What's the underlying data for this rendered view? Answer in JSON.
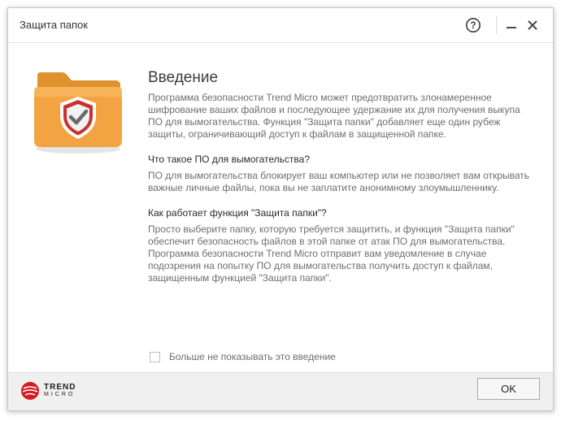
{
  "window": {
    "title": "Защита папок",
    "help_label": "?"
  },
  "intro": {
    "heading": "Введение",
    "paragraph": "Программа безопасности Trend Micro может предотвратить злонамеренное шифрование ваших файлов и последующее удержание их для получения выкупа ПО для вымогательства. Функция \"Защита папки\" добавляет еще один рубеж защиты, ограничивающий доступ к файлам в защищенной папке.",
    "q1": "Что такое ПО для вымогательства?",
    "a1": "ПО для вымогательства блокирует ваш компьютер или не позволяет вам открывать важные личные файлы, пока вы не заплатите анонимному злоумышленнику.",
    "q2": "Как работает функция \"Защита папки\"?",
    "a2": "Просто выберите папку, которую требуется защитить, и функция \"Защита папки\" обеспечит безопасность файлов в этой папке от атак ПО для вымогательства. Программа безопасности Trend Micro отправит вам уведомление в случае подозрения на попытку ПО для вымогательства получить доступ к файлам, защищенным функцией \"Защита папки\"."
  },
  "dont_show": {
    "label": "Больше не показывать это введение",
    "checked": false
  },
  "footer": {
    "logo_line1": "TREND",
    "logo_line2": "MICRO",
    "ok_label": "OK"
  },
  "colors": {
    "folder": "#f4a342",
    "shield": "#c6332c",
    "logo_red": "#d71921"
  },
  "icons": [
    "help-icon",
    "minimize-icon",
    "close-icon",
    "shield-folder-icon",
    "trend-micro-logo"
  ]
}
